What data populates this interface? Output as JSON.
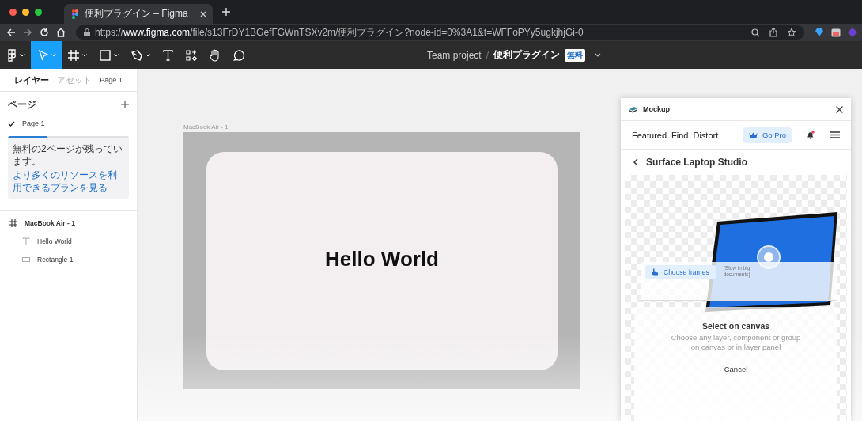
{
  "browser": {
    "tabs": [
      {
        "title": "便利プラグイン – Figma",
        "selected": true
      }
    ],
    "url": "https://**www.figma.com**/file/s13FrDY1BGefFGWnTSXv2m/便利プラグイン?node-id=0%3A1&t=WFFoPYy5ugkjhjGi-0"
  },
  "toolbar": {
    "tools": [
      {
        "kind": "menu",
        "has_menu": true,
        "selected": false
      },
      {
        "kind": "move",
        "has_menu": true,
        "selected": true
      },
      {
        "kind": "frame",
        "has_menu": true,
        "selected": false
      },
      {
        "kind": "rectangle",
        "has_menu": true,
        "selected": false
      },
      {
        "kind": "pen",
        "has_menu": true,
        "selected": false
      },
      {
        "kind": "text",
        "has_menu": false,
        "selected": false
      },
      {
        "kind": "resources",
        "has_menu": false,
        "selected": false
      },
      {
        "kind": "hand",
        "has_menu": false,
        "selected": false
      },
      {
        "kind": "comment",
        "has_menu": false,
        "selected": false
      }
    ],
    "project": "Team project",
    "separator": "/",
    "file": "便利プラグイン",
    "badge": "無料"
  },
  "left_panel": {
    "tabs": [
      {
        "label": "レイヤー",
        "selected": true
      },
      {
        "label": "アセット",
        "selected": false
      }
    ],
    "page_picker": "Page 1",
    "pages_heading": "ページ",
    "pages": [
      {
        "label": "Page 1",
        "selected": true
      }
    ],
    "notice": {
      "level": 0.33,
      "text": "無料の2ページが残っています。",
      "link": "より多くのリソースを利用できるプランを見る"
    },
    "layers": [
      {
        "name": "MacBook Air - 1",
        "kind": "frame",
        "children": [
          {
            "name": "Hello World",
            "kind": "text"
          },
          {
            "name": "Rectangle 1",
            "kind": "rectangle"
          }
        ]
      }
    ]
  },
  "canvas": {
    "frame_label": "MacBook Air - 1",
    "text": "Hello World"
  },
  "plugin": {
    "title": "Mockup",
    "tabs": [
      "Featured",
      "Find",
      "Distort"
    ],
    "go_pro": "Go Pro",
    "heading": "Surface Laptop Studio",
    "choose_frames": "Choose frames",
    "note": "(Slow in big documents)",
    "dialog": {
      "title": "Select on canvas",
      "body": "Choose any layer, component or group on canvas or in layer panel",
      "cancel": "Cancel"
    }
  }
}
